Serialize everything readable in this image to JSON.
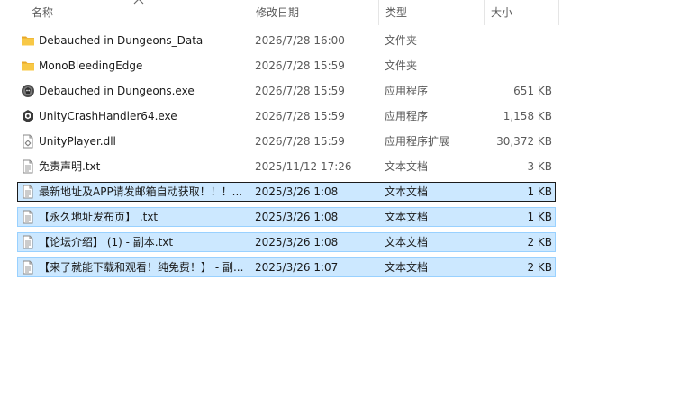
{
  "columns": {
    "name": "名称",
    "date": "修改日期",
    "type": "类型",
    "size": "大小"
  },
  "files": [
    {
      "name": "Debauched in Dungeons_Data",
      "date": "2026/7/28 16:00",
      "type": "文件夹",
      "size": "",
      "icon": "folder-icon"
    },
    {
      "name": "MonoBleedingEdge",
      "date": "2026/7/28 15:59",
      "type": "文件夹",
      "size": "",
      "icon": "folder-icon"
    },
    {
      "name": "Debauched in Dungeons.exe",
      "date": "2026/7/28 15:59",
      "type": "应用程序",
      "size": "651 KB",
      "icon": "game-app-icon"
    },
    {
      "name": "UnityCrashHandler64.exe",
      "date": "2026/7/28 15:59",
      "type": "应用程序",
      "size": "1,158 KB",
      "icon": "unity-app-icon"
    },
    {
      "name": "UnityPlayer.dll",
      "date": "2026/7/28 15:59",
      "type": "应用程序扩展",
      "size": "30,372 KB",
      "icon": "dll-file-icon"
    },
    {
      "name": "免责声明.txt",
      "date": "2025/11/12 17:26",
      "type": "文本文档",
      "size": "3 KB",
      "icon": "text-file-icon"
    },
    {
      "name": "最新地址及APP请发邮箱自动获取！！！...",
      "date": "2025/3/26 1:08",
      "type": "文本文档",
      "size": "1 KB",
      "icon": "text-file-icon"
    },
    {
      "name": "【永久地址发布页】 .txt",
      "date": "2025/3/26 1:08",
      "type": "文本文档",
      "size": "1 KB",
      "icon": "text-file-icon"
    },
    {
      "name": "【论坛介绍】 (1) - 副本.txt",
      "date": "2025/3/26 1:08",
      "type": "文本文档",
      "size": "2 KB",
      "icon": "text-file-icon"
    },
    {
      "name": "【来了就能下载和观看！纯免费！】 - 副...",
      "date": "2025/3/26 1:07",
      "type": "文本文档",
      "size": "2 KB",
      "icon": "text-file-icon"
    }
  ],
  "selection": {
    "selected_rows": [
      6,
      7,
      8,
      9
    ],
    "focused_row": 6
  },
  "colors": {
    "selection_fill": "#cce8ff",
    "selection_border": "#99d1ff",
    "folder": "#f8c846"
  }
}
